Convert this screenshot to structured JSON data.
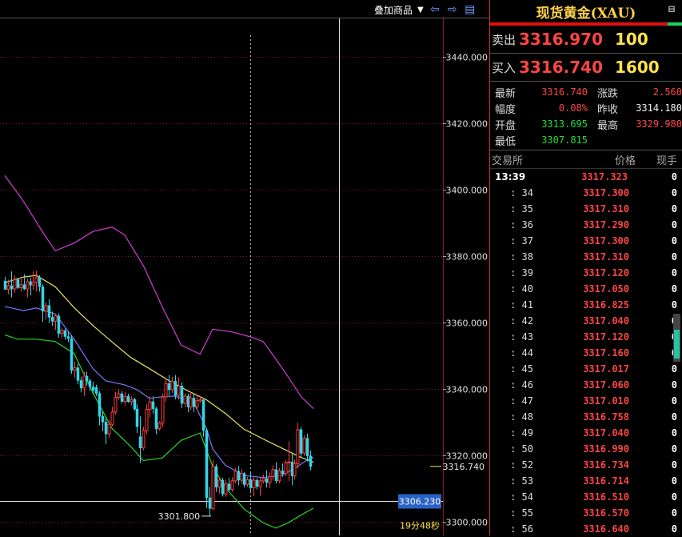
{
  "toolbar": {
    "overlay_label": "叠加商品",
    "dropdown_glyph": "▼",
    "back_glyph": "⇦",
    "fwd_glyph": "⇨",
    "layout_glyph": "▤"
  },
  "panel": {
    "title": "现货黄金(XAU)",
    "bell_glyph": "⊟",
    "sell": {
      "label": "卖出",
      "price": "3316.970",
      "volume": "100"
    },
    "buy": {
      "label": "买入",
      "price": "3316.740",
      "volume": "1600"
    },
    "stats": [
      {
        "k": "最新",
        "v": "3316.740",
        "vc": "red",
        "k2": "涨跌",
        "v2": "2.560",
        "v2c": "red"
      },
      {
        "k": "幅度",
        "v": "0.08%",
        "vc": "red",
        "k2": "昨收",
        "v2": "3314.180",
        "v2c": "white"
      },
      {
        "k": "开盘",
        "v": "3313.695",
        "vc": "green",
        "k2": "最高",
        "v2": "3329.980",
        "v2c": "red"
      },
      {
        "k": "最低",
        "v": "3307.815",
        "vc": "green",
        "k2": "",
        "v2": "",
        "v2c": "white"
      }
    ],
    "tick_headers": {
      "exchange": "交易所",
      "price": "价格",
      "qty": "现手"
    },
    "ticks": [
      {
        "t": "13:39",
        "p": "3317.323",
        "q": "0"
      },
      {
        "t": ": 34",
        "p": "3317.300",
        "q": "0"
      },
      {
        "t": ": 35",
        "p": "3317.310",
        "q": "0"
      },
      {
        "t": ": 36",
        "p": "3317.290",
        "q": "0"
      },
      {
        "t": ": 37",
        "p": "3317.300",
        "q": "0"
      },
      {
        "t": ": 38",
        "p": "3317.310",
        "q": "0"
      },
      {
        "t": ": 39",
        "p": "3317.120",
        "q": "0"
      },
      {
        "t": ": 40",
        "p": "3317.050",
        "q": "0"
      },
      {
        "t": ": 41",
        "p": "3316.825",
        "q": "0"
      },
      {
        "t": ": 42",
        "p": "3317.040",
        "q": "0"
      },
      {
        "t": ": 43",
        "p": "3317.120",
        "q": "0"
      },
      {
        "t": ": 44",
        "p": "3317.160",
        "q": "0"
      },
      {
        "t": ": 45",
        "p": "3317.017",
        "q": "0"
      },
      {
        "t": ": 46",
        "p": "3317.060",
        "q": "0"
      },
      {
        "t": ": 47",
        "p": "3317.010",
        "q": "0"
      },
      {
        "t": ": 48",
        "p": "3316.758",
        "q": "0"
      },
      {
        "t": ": 49",
        "p": "3317.040",
        "q": "0"
      },
      {
        "t": ": 50",
        "p": "3316.990",
        "q": "0"
      },
      {
        "t": ": 52",
        "p": "3316.734",
        "q": "0"
      },
      {
        "t": ": 53",
        "p": "3316.714",
        "q": "0"
      },
      {
        "t": ": 54",
        "p": "3316.510",
        "q": "0"
      },
      {
        "t": ": 55",
        "p": "3316.570",
        "q": "0"
      },
      {
        "t": ": 56",
        "p": "3316.640",
        "q": "0"
      }
    ]
  },
  "chart_data": {
    "type": "candlestick",
    "ylim": [
      3296,
      3457
    ],
    "yticks": [
      3300,
      3320,
      3340,
      3360,
      3380,
      3400,
      3420,
      3440
    ],
    "ytick_labels": [
      "3300.000",
      "3320.000",
      "3340.000",
      "3360.000",
      "3380.000",
      "3400.000",
      "3420.000",
      "3440.000"
    ],
    "current_price": 3316.74,
    "current_price_label": "3316.740",
    "crosshair_price": 3306.23,
    "crosshair_label": "3306.230",
    "low_marker": {
      "index": 65,
      "value": 3301.8,
      "label": "3301.800"
    },
    "countdown_label": "19分48秒",
    "crosshair_index": 106,
    "vline_dashed_index": 78,
    "colors": {
      "up": "#ff3b3b",
      "down": "#2fd7e8",
      "ma_fast": "#7a7aff",
      "ma_slow": "#e8e85a",
      "band_upper": "#d63bd6",
      "band_lower": "#2ad42a",
      "grid": "#8b1a1a"
    },
    "candles": [
      [
        3372.5,
        3373.8,
        3369.9,
        3370.0
      ],
      [
        3370.0,
        3372.9,
        3368.5,
        3371.1
      ],
      [
        3371.1,
        3375.4,
        3367.6,
        3370.1
      ],
      [
        3370.1,
        3374.2,
        3368.9,
        3372.9
      ],
      [
        3372.9,
        3373.4,
        3370.1,
        3370.5
      ],
      [
        3370.5,
        3373.8,
        3369.3,
        3371.4
      ],
      [
        3371.4,
        3374.5,
        3369.8,
        3370.1
      ],
      [
        3370.1,
        3373.3,
        3367.6,
        3372.3
      ],
      [
        3372.3,
        3373.5,
        3368.2,
        3371.3
      ],
      [
        3371.3,
        3375.4,
        3369.8,
        3372.1
      ],
      [
        3372.1,
        3375.6,
        3369.4,
        3373.5
      ],
      [
        3373.5,
        3374.2,
        3369.3,
        3370.8
      ],
      [
        3370.8,
        3371.5,
        3360.2,
        3363.4
      ],
      [
        3363.4,
        3366.2,
        3360.9,
        3365.1
      ],
      [
        3365.1,
        3367.0,
        3359.9,
        3361.6
      ],
      [
        3361.6,
        3363.3,
        3359.0,
        3360.4
      ],
      [
        3360.4,
        3362.7,
        3357.8,
        3362.0
      ],
      [
        3362.0,
        3362.8,
        3355.4,
        3356.7
      ],
      [
        3356.7,
        3358.3,
        3355.3,
        3357.6
      ],
      [
        3357.6,
        3358.2,
        3354.8,
        3355.8
      ],
      [
        3355.8,
        3357.2,
        3354.1,
        3355.2
      ],
      [
        3355.2,
        3356.2,
        3344.6,
        3345.6
      ],
      [
        3345.6,
        3348.3,
        3343.4,
        3346.4
      ],
      [
        3346.4,
        3347.6,
        3341.4,
        3342.6
      ],
      [
        3342.6,
        3343.7,
        3339.0,
        3340.3
      ],
      [
        3340.3,
        3345.1,
        3337.9,
        3343.9
      ],
      [
        3343.9,
        3345.2,
        3341.1,
        3342.5
      ],
      [
        3342.5,
        3343.1,
        3339.4,
        3340.7
      ],
      [
        3340.7,
        3342.2,
        3338.5,
        3339.6
      ],
      [
        3340.5,
        3341.3,
        3337.9,
        3338.7
      ],
      [
        3338.7,
        3339.4,
        3329.1,
        3331.8
      ],
      [
        3331.8,
        3333.4,
        3327.4,
        3330.1
      ],
      [
        3330.1,
        3331.3,
        3323.4,
        3326.5
      ],
      [
        3326.5,
        3330.6,
        3325.4,
        3329.4
      ],
      [
        3329.4,
        3334.7,
        3328.8,
        3333.1
      ],
      [
        3333.1,
        3339.1,
        3332.3,
        3337.5
      ],
      [
        3337.5,
        3340.1,
        3336.8,
        3338.6
      ],
      [
        3338.6,
        3339.4,
        3335.7,
        3336.3
      ],
      [
        3336.3,
        3339.2,
        3335.1,
        3337.8
      ],
      [
        3337.8,
        3338.6,
        3335.9,
        3336.2
      ],
      [
        3336.2,
        3337.8,
        3335.1,
        3336.9
      ],
      [
        3336.9,
        3337.4,
        3333.5,
        3334.0
      ],
      [
        3334.0,
        3335.4,
        3326.8,
        3328.7
      ],
      [
        3325.7,
        3331.8,
        3317.8,
        3322.3
      ],
      [
        3322.3,
        3328.6,
        3321.6,
        3327.5
      ],
      [
        3327.5,
        3335.4,
        3326.4,
        3333.9
      ],
      [
        3333.9,
        3337.8,
        3331.5,
        3336.2
      ],
      [
        3336.2,
        3337.8,
        3332.6,
        3334.1
      ],
      [
        3334.1,
        3334.7,
        3326.4,
        3328.1
      ],
      [
        3328.1,
        3330.3,
        3327.5,
        3329.8
      ],
      [
        3329.8,
        3338.7,
        3328.6,
        3337.6
      ],
      [
        3337.6,
        3343.5,
        3336.2,
        3341.7
      ],
      [
        3341.7,
        3344.2,
        3338.1,
        3339.8
      ],
      [
        3339.8,
        3343.7,
        3338.8,
        3342.4
      ],
      [
        3342.4,
        3344.2,
        3336.9,
        3338.1
      ],
      [
        3338.1,
        3343.5,
        3336.8,
        3340.9
      ],
      [
        3340.9,
        3342.1,
        3334.2,
        3335.7
      ],
      [
        3335.7,
        3338.8,
        3334.6,
        3337.9
      ],
      [
        3337.9,
        3338.7,
        3333.1,
        3334.6
      ],
      [
        3334.6,
        3339.1,
        3333.7,
        3337.3
      ],
      [
        3337.3,
        3338.6,
        3333.1,
        3334.7
      ],
      [
        3334.7,
        3338.3,
        3333.6,
        3336.5
      ],
      [
        3336.5,
        3337.8,
        3335.9,
        3336.8
      ],
      [
        3336.8,
        3336.9,
        3325.7,
        3327.6
      ],
      [
        3327.6,
        3328.3,
        3304.2,
        3307.3
      ],
      [
        3307.3,
        3310.6,
        3301.8,
        3304.1
      ],
      [
        3304.1,
        3318.6,
        3303.5,
        3316.7
      ],
      [
        3316.7,
        3317.4,
        3309.1,
        3310.5
      ],
      [
        3310.5,
        3313.6,
        3308.6,
        3312.6
      ],
      [
        3312.6,
        3313.4,
        3307.7,
        3308.4
      ],
      [
        3308.4,
        3312.8,
        3307.6,
        3311.5
      ],
      [
        3311.5,
        3313.3,
        3308.9,
        3309.8
      ],
      [
        3309.8,
        3313.5,
        3309.1,
        3312.4
      ],
      [
        3312.4,
        3316.2,
        3311.7,
        3315.3
      ],
      [
        3315.3,
        3316.8,
        3311.1,
        3312.6
      ],
      [
        3312.6,
        3315.9,
        3311.6,
        3314.6
      ],
      [
        3314.6,
        3315.0,
        3310.4,
        3311.3
      ],
      [
        3311.3,
        3313.6,
        3310.6,
        3312.8
      ],
      [
        3312.8,
        3314.9,
        3309.1,
        3310.3
      ],
      [
        3310.3,
        3313.8,
        3307.8,
        3312.6
      ],
      [
        3312.6,
        3313.2,
        3309.8,
        3310.7
      ],
      [
        3310.7,
        3313.4,
        3307.9,
        3312.4
      ],
      [
        3312.4,
        3314.3,
        3311.6,
        3313.1
      ],
      [
        3313.1,
        3315.6,
        3310.4,
        3311.9
      ],
      [
        3311.9,
        3314.9,
        3310.3,
        3313.7
      ],
      [
        3313.7,
        3317.1,
        3312.5,
        3315.8
      ],
      [
        3315.8,
        3318.0,
        3311.6,
        3312.4
      ],
      [
        3312.4,
        3316.3,
        3311.7,
        3315.4
      ],
      [
        3315.4,
        3317.6,
        3313.6,
        3314.6
      ],
      [
        3314.6,
        3318.7,
        3313.8,
        3317.9
      ],
      [
        3317.9,
        3324.3,
        3312.4,
        3318.1
      ],
      [
        3318.1,
        3320.7,
        3311.1,
        3313.9
      ],
      [
        3313.9,
        3318.8,
        3312.8,
        3317.6
      ],
      [
        3317.6,
        3329.9,
        3316.1,
        3327.8
      ],
      [
        3327.8,
        3328.6,
        3319.6,
        3320.7
      ],
      [
        3320.7,
        3326.1,
        3319.9,
        3325.2
      ],
      [
        3325.2,
        3326.6,
        3318.2,
        3319.9
      ],
      [
        3319.9,
        3321.5,
        3315.6,
        3316.7
      ]
    ],
    "ma_fast": [
      [
        0,
        3364.8
      ],
      [
        6,
        3363.6
      ],
      [
        10,
        3364.4
      ],
      [
        16,
        3362.6
      ],
      [
        22,
        3355.0
      ],
      [
        28,
        3346.1
      ],
      [
        32,
        3342.5
      ],
      [
        38,
        3341.3
      ],
      [
        42,
        3339.8
      ],
      [
        46,
        3337.2
      ],
      [
        50,
        3337.7
      ],
      [
        54,
        3337.9
      ],
      [
        60,
        3335.8
      ],
      [
        64,
        3328.2
      ],
      [
        66,
        3322.0
      ],
      [
        70,
        3317.1
      ],
      [
        76,
        3314.0
      ],
      [
        82,
        3313.4
      ],
      [
        88,
        3314.1
      ],
      [
        92,
        3316.2
      ],
      [
        96,
        3318.7
      ],
      [
        98,
        3319.5
      ]
    ],
    "ma_slow": [
      [
        0,
        3372.0
      ],
      [
        6,
        3373.7
      ],
      [
        10,
        3374.2
      ],
      [
        16,
        3370.8
      ],
      [
        22,
        3364.5
      ],
      [
        28,
        3359.1
      ],
      [
        34,
        3354.2
      ],
      [
        40,
        3349.5
      ],
      [
        46,
        3346.1
      ],
      [
        52,
        3342.6
      ],
      [
        58,
        3339.5
      ],
      [
        64,
        3336.8
      ],
      [
        70,
        3332.7
      ],
      [
        76,
        3327.9
      ],
      [
        82,
        3325.0
      ],
      [
        88,
        3322.2
      ],
      [
        94,
        3319.5
      ],
      [
        98,
        3318.0
      ]
    ],
    "band_upper": [
      [
        0,
        3404.2
      ],
      [
        6,
        3396.4
      ],
      [
        12,
        3387.2
      ],
      [
        16,
        3381.6
      ],
      [
        22,
        3383.9
      ],
      [
        28,
        3387.4
      ],
      [
        34,
        3388.7
      ],
      [
        38,
        3386.4
      ],
      [
        44,
        3377.1
      ],
      [
        50,
        3364.7
      ],
      [
        56,
        3353.2
      ],
      [
        62,
        3350.5
      ],
      [
        66,
        3358.0
      ],
      [
        72,
        3357.2
      ],
      [
        78,
        3355.7
      ],
      [
        82,
        3354.3
      ],
      [
        86,
        3349.1
      ],
      [
        90,
        3343.6
      ],
      [
        94,
        3337.8
      ],
      [
        98,
        3334.1
      ]
    ],
    "band_lower": [
      [
        0,
        3356.3
      ],
      [
        4,
        3355.0
      ],
      [
        10,
        3355.0
      ],
      [
        16,
        3354.3
      ],
      [
        22,
        3350.7
      ],
      [
        28,
        3338.8
      ],
      [
        34,
        3328.2
      ],
      [
        40,
        3322.7
      ],
      [
        44,
        3318.5
      ],
      [
        50,
        3319.3
      ],
      [
        56,
        3324.6
      ],
      [
        62,
        3326.8
      ],
      [
        66,
        3316.8
      ],
      [
        70,
        3310.4
      ],
      [
        76,
        3303.9
      ],
      [
        82,
        3299.8
      ],
      [
        86,
        3298.2
      ],
      [
        90,
        3299.8
      ],
      [
        94,
        3302.1
      ],
      [
        98,
        3304.2
      ]
    ]
  }
}
